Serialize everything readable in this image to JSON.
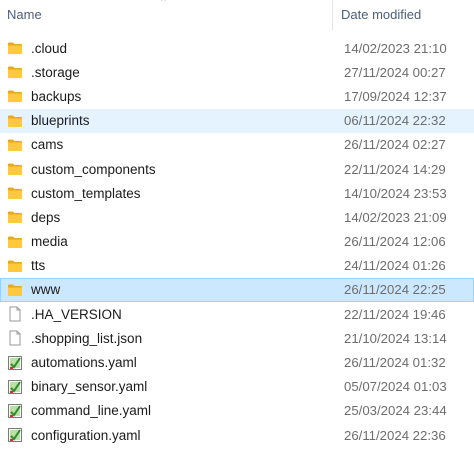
{
  "columns": {
    "name": "Name",
    "date_modified": "Date modified"
  },
  "files": [
    {
      "name": ".cloud",
      "date": "14/02/2023 21:10",
      "icon": "folder-icon",
      "state": ""
    },
    {
      "name": ".storage",
      "date": "27/11/2024 00:27",
      "icon": "folder-icon",
      "state": ""
    },
    {
      "name": "backups",
      "date": "17/09/2024 12:37",
      "icon": "folder-icon",
      "state": ""
    },
    {
      "name": "blueprints",
      "date": "06/11/2024 22:32",
      "icon": "folder-icon",
      "state": "selected"
    },
    {
      "name": "cams",
      "date": "26/11/2024 02:27",
      "icon": "folder-icon",
      "state": ""
    },
    {
      "name": "custom_components",
      "date": "22/11/2024 14:29",
      "icon": "folder-icon",
      "state": ""
    },
    {
      "name": "custom_templates",
      "date": "14/10/2024 23:53",
      "icon": "folder-icon",
      "state": ""
    },
    {
      "name": "deps",
      "date": "14/02/2023 21:09",
      "icon": "folder-icon",
      "state": ""
    },
    {
      "name": "media",
      "date": "26/11/2024 12:06",
      "icon": "folder-icon",
      "state": ""
    },
    {
      "name": "tts",
      "date": "24/11/2024 01:26",
      "icon": "folder-icon",
      "state": ""
    },
    {
      "name": "www",
      "date": "26/11/2024 22:25",
      "icon": "folder-icon",
      "state": "focused"
    },
    {
      "name": ".HA_VERSION",
      "date": "22/11/2024 19:46",
      "icon": "file-icon",
      "state": ""
    },
    {
      "name": ".shopping_list.json",
      "date": "21/10/2024 13:14",
      "icon": "file-icon",
      "state": ""
    },
    {
      "name": "automations.yaml",
      "date": "26/11/2024 01:32",
      "icon": "yaml-file-icon",
      "state": ""
    },
    {
      "name": "binary_sensor.yaml",
      "date": "05/07/2024 01:03",
      "icon": "yaml-file-icon",
      "state": ""
    },
    {
      "name": "command_line.yaml",
      "date": "25/03/2024 23:44",
      "icon": "yaml-file-icon",
      "state": ""
    },
    {
      "name": "configuration.yaml",
      "date": "26/11/2024 22:36",
      "icon": "yaml-file-icon",
      "state": ""
    }
  ],
  "colors": {
    "header_text": "#4c607a",
    "selected_bg": "#e5f3ff",
    "focused_bg": "#cce8ff",
    "focused_border": "#99d1ff",
    "folder": "#ffc83d"
  }
}
